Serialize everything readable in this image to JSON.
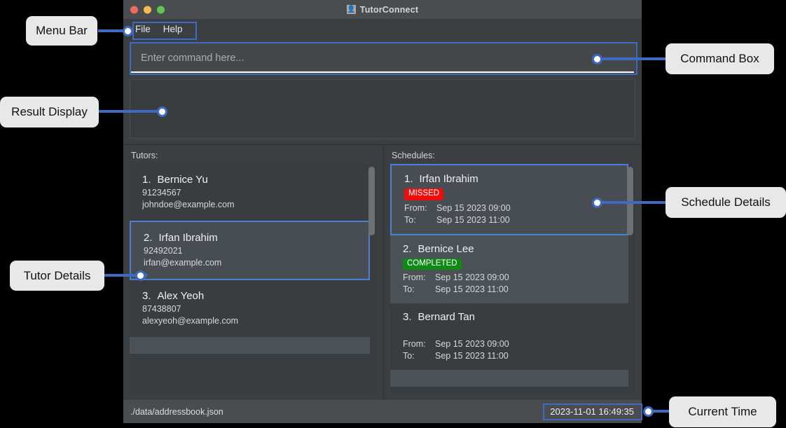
{
  "window": {
    "title": "TutorConnect",
    "icon": "user-icon",
    "traffic_lights": [
      "close-button",
      "minimize-button",
      "maximize-button"
    ]
  },
  "menubar": {
    "items": [
      {
        "label": "File"
      },
      {
        "label": "Help"
      }
    ]
  },
  "command_box": {
    "placeholder": "Enter command here...",
    "value": ""
  },
  "result_display": {
    "text": ""
  },
  "tutors_panel": {
    "label": "Tutors:",
    "items": [
      {
        "index": "1.",
        "name": "Bernice Yu",
        "phone": "91234567",
        "email": "johndoe@example.com",
        "selected": false
      },
      {
        "index": "2.",
        "name": "Irfan Ibrahim",
        "phone": "92492021",
        "email": "irfan@example.com",
        "selected": true
      },
      {
        "index": "3.",
        "name": "Alex Yeoh",
        "phone": "87438807",
        "email": "alexyeoh@example.com",
        "selected": false
      }
    ]
  },
  "schedules_panel": {
    "label": "Schedules:",
    "from_key": "From:",
    "to_key": "To:",
    "items": [
      {
        "index": "1.",
        "name": "Irfan Ibrahim",
        "status": "MISSED",
        "status_color": "#f10c0c",
        "from": "Sep 15 2023 09:00",
        "to": "Sep 15 2023 11:00",
        "selected": true
      },
      {
        "index": "2.",
        "name": "Bernice Lee",
        "status": "COMPLETED",
        "status_color": "#0f8a14",
        "from": "Sep 15 2023 09:00",
        "to": "Sep 15 2023 11:00",
        "selected": false
      },
      {
        "index": "3.",
        "name": "Bernard Tan",
        "status": "",
        "status_color": "",
        "from": "Sep 15 2023 09:00",
        "to": "Sep 15 2023 11:00",
        "selected": false
      }
    ]
  },
  "statusbar": {
    "file_path": "./data/addressbook.json",
    "current_time": "2023-11-01 16:49:35"
  },
  "annotations": {
    "accent_color": "#4069c0",
    "labels": [
      {
        "text": "Menu Bar"
      },
      {
        "text": "Command Box"
      },
      {
        "text": "Result Display"
      },
      {
        "text": "Schedule Details"
      },
      {
        "text": "Tutor Details"
      },
      {
        "text": "Current Time"
      }
    ]
  }
}
